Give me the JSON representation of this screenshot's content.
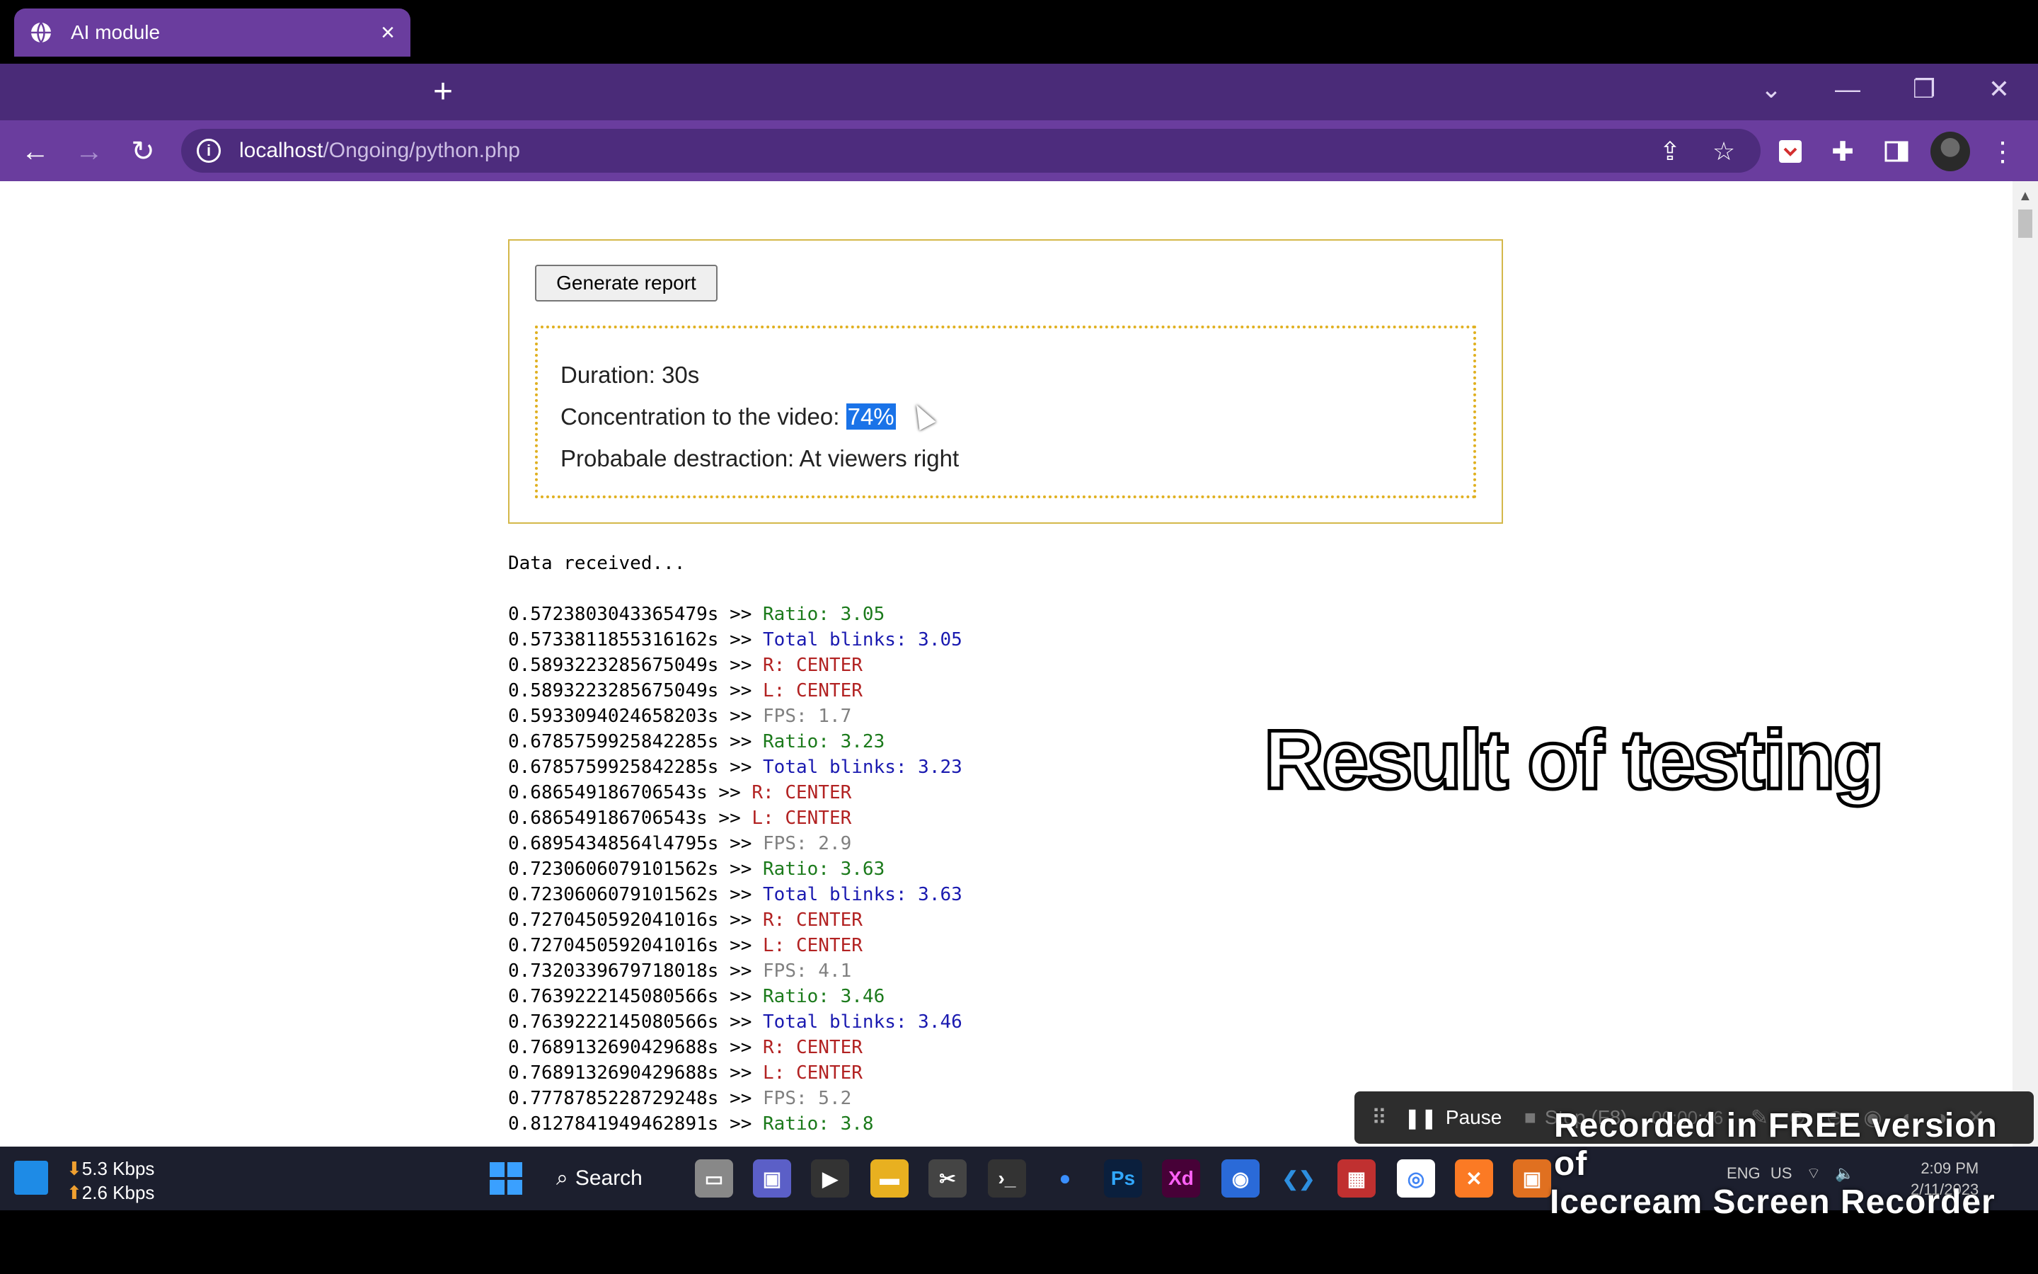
{
  "browser": {
    "tab_title": "AI module",
    "tab_close": "×",
    "new_tab": "+",
    "url_host": "localhost",
    "url_path": "/Ongoing/python.php"
  },
  "report": {
    "button_label": "Generate report",
    "duration_label": "Duration: 30s",
    "concentration_label": "Concentration to the video: ",
    "concentration_value": "74%",
    "distraction_label": "Probabale destraction: At viewers right"
  },
  "log": {
    "header": "Data received...",
    "lines": [
      {
        "time": "0.5723803043365479s >> ",
        "msg": "Ratio: 3.05",
        "kind": "ratio"
      },
      {
        "time": "0.5733811855316162s >> ",
        "msg": "Total blinks: 3.05",
        "kind": "blinks"
      },
      {
        "time": "0.5893223285675049s >> ",
        "msg": "R: CENTER",
        "kind": "dir"
      },
      {
        "time": "0.5893223285675049s >> ",
        "msg": "L: CENTER",
        "kind": "dir"
      },
      {
        "time": "0.5933094024658203s >> ",
        "msg": "FPS: 1.7",
        "kind": "fps"
      },
      {
        "time": "0.6785759925842285s >> ",
        "msg": "Ratio: 3.23",
        "kind": "ratio"
      },
      {
        "time": "0.6785759925842285s >> ",
        "msg": "Total blinks: 3.23",
        "kind": "blinks"
      },
      {
        "time": "0.686549186706543s >> ",
        "msg": "R: CENTER",
        "kind": "dir"
      },
      {
        "time": "0.686549186706543s >> ",
        "msg": "L: CENTER",
        "kind": "dir"
      },
      {
        "time": "0.68954348564l4795s >> ",
        "msg": "FPS: 2.9",
        "kind": "fps"
      },
      {
        "time": "0.7230606079101562s >> ",
        "msg": "Ratio: 3.63",
        "kind": "ratio"
      },
      {
        "time": "0.7230606079101562s >> ",
        "msg": "Total blinks: 3.63",
        "kind": "blinks"
      },
      {
        "time": "0.7270450592041016s >> ",
        "msg": "R: CENTER",
        "kind": "dir"
      },
      {
        "time": "0.7270450592041016s >> ",
        "msg": "L: CENTER",
        "kind": "dir"
      },
      {
        "time": "0.7320339679718018s >> ",
        "msg": "FPS: 4.1",
        "kind": "fps"
      },
      {
        "time": "0.7639222145080566s >> ",
        "msg": "Ratio: 3.46",
        "kind": "ratio"
      },
      {
        "time": "0.7639222145080566s >> ",
        "msg": "Total blinks: 3.46",
        "kind": "blinks"
      },
      {
        "time": "0.7689132690429688s >> ",
        "msg": "R: CENTER",
        "kind": "dir"
      },
      {
        "time": "0.7689132690429688s >> ",
        "msg": "L: CENTER",
        "kind": "dir"
      },
      {
        "time": "0.7778785228729248s >> ",
        "msg": "FPS: 5.2",
        "kind": "fps"
      },
      {
        "time": "0.8127841949462891s >> ",
        "msg": "Ratio: 3.8",
        "kind": "ratio"
      }
    ]
  },
  "overlay_caption": "Result of testing",
  "recorder": {
    "pause_label": "Pause",
    "stop_label": "Stop (F8)",
    "elapsed": "00:00:46"
  },
  "taskbar": {
    "net_down": "5.3 Kbps",
    "net_up": "2.6 Kbps",
    "search_label": "Search",
    "lang": "ENG",
    "region": "US",
    "time": "2:09 PM",
    "date": "2/11/2023"
  },
  "watermark": {
    "line1": "Recorded in FREE version of",
    "line2": "Icecream Screen Recorder"
  },
  "colors": {
    "ratio": "#1b7a1b",
    "blinks": "#1a1ab0",
    "dir": "#b22222",
    "fps": "#808080",
    "chrome_purple": "#6a3d9e"
  }
}
